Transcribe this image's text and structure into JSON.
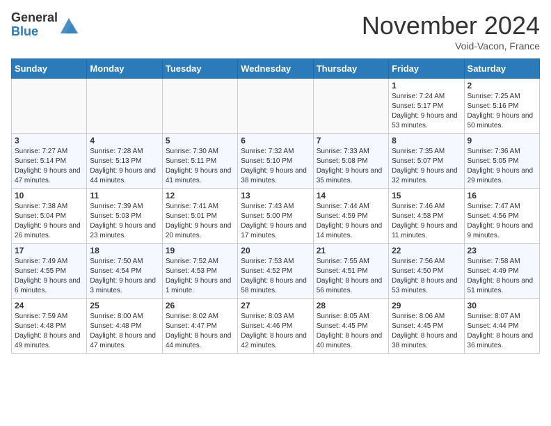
{
  "logo": {
    "general": "General",
    "blue": "Blue"
  },
  "header": {
    "month": "November 2024",
    "location": "Void-Vacon, France"
  },
  "weekdays": [
    "Sunday",
    "Monday",
    "Tuesday",
    "Wednesday",
    "Thursday",
    "Friday",
    "Saturday"
  ],
  "weeks": [
    [
      {
        "day": "",
        "info": ""
      },
      {
        "day": "",
        "info": ""
      },
      {
        "day": "",
        "info": ""
      },
      {
        "day": "",
        "info": ""
      },
      {
        "day": "",
        "info": ""
      },
      {
        "day": "1",
        "info": "Sunrise: 7:24 AM\nSunset: 5:17 PM\nDaylight: 9 hours and 53 minutes."
      },
      {
        "day": "2",
        "info": "Sunrise: 7:25 AM\nSunset: 5:16 PM\nDaylight: 9 hours and 50 minutes."
      }
    ],
    [
      {
        "day": "3",
        "info": "Sunrise: 7:27 AM\nSunset: 5:14 PM\nDaylight: 9 hours and 47 minutes."
      },
      {
        "day": "4",
        "info": "Sunrise: 7:28 AM\nSunset: 5:13 PM\nDaylight: 9 hours and 44 minutes."
      },
      {
        "day": "5",
        "info": "Sunrise: 7:30 AM\nSunset: 5:11 PM\nDaylight: 9 hours and 41 minutes."
      },
      {
        "day": "6",
        "info": "Sunrise: 7:32 AM\nSunset: 5:10 PM\nDaylight: 9 hours and 38 minutes."
      },
      {
        "day": "7",
        "info": "Sunrise: 7:33 AM\nSunset: 5:08 PM\nDaylight: 9 hours and 35 minutes."
      },
      {
        "day": "8",
        "info": "Sunrise: 7:35 AM\nSunset: 5:07 PM\nDaylight: 9 hours and 32 minutes."
      },
      {
        "day": "9",
        "info": "Sunrise: 7:36 AM\nSunset: 5:05 PM\nDaylight: 9 hours and 29 minutes."
      }
    ],
    [
      {
        "day": "10",
        "info": "Sunrise: 7:38 AM\nSunset: 5:04 PM\nDaylight: 9 hours and 26 minutes."
      },
      {
        "day": "11",
        "info": "Sunrise: 7:39 AM\nSunset: 5:03 PM\nDaylight: 9 hours and 23 minutes."
      },
      {
        "day": "12",
        "info": "Sunrise: 7:41 AM\nSunset: 5:01 PM\nDaylight: 9 hours and 20 minutes."
      },
      {
        "day": "13",
        "info": "Sunrise: 7:43 AM\nSunset: 5:00 PM\nDaylight: 9 hours and 17 minutes."
      },
      {
        "day": "14",
        "info": "Sunrise: 7:44 AM\nSunset: 4:59 PM\nDaylight: 9 hours and 14 minutes."
      },
      {
        "day": "15",
        "info": "Sunrise: 7:46 AM\nSunset: 4:58 PM\nDaylight: 9 hours and 11 minutes."
      },
      {
        "day": "16",
        "info": "Sunrise: 7:47 AM\nSunset: 4:56 PM\nDaylight: 9 hours and 9 minutes."
      }
    ],
    [
      {
        "day": "17",
        "info": "Sunrise: 7:49 AM\nSunset: 4:55 PM\nDaylight: 9 hours and 6 minutes."
      },
      {
        "day": "18",
        "info": "Sunrise: 7:50 AM\nSunset: 4:54 PM\nDaylight: 9 hours and 3 minutes."
      },
      {
        "day": "19",
        "info": "Sunrise: 7:52 AM\nSunset: 4:53 PM\nDaylight: 9 hours and 1 minute."
      },
      {
        "day": "20",
        "info": "Sunrise: 7:53 AM\nSunset: 4:52 PM\nDaylight: 8 hours and 58 minutes."
      },
      {
        "day": "21",
        "info": "Sunrise: 7:55 AM\nSunset: 4:51 PM\nDaylight: 8 hours and 56 minutes."
      },
      {
        "day": "22",
        "info": "Sunrise: 7:56 AM\nSunset: 4:50 PM\nDaylight: 8 hours and 53 minutes."
      },
      {
        "day": "23",
        "info": "Sunrise: 7:58 AM\nSunset: 4:49 PM\nDaylight: 8 hours and 51 minutes."
      }
    ],
    [
      {
        "day": "24",
        "info": "Sunrise: 7:59 AM\nSunset: 4:48 PM\nDaylight: 8 hours and 49 minutes."
      },
      {
        "day": "25",
        "info": "Sunrise: 8:00 AM\nSunset: 4:48 PM\nDaylight: 8 hours and 47 minutes."
      },
      {
        "day": "26",
        "info": "Sunrise: 8:02 AM\nSunset: 4:47 PM\nDaylight: 8 hours and 44 minutes."
      },
      {
        "day": "27",
        "info": "Sunrise: 8:03 AM\nSunset: 4:46 PM\nDaylight: 8 hours and 42 minutes."
      },
      {
        "day": "28",
        "info": "Sunrise: 8:05 AM\nSunset: 4:45 PM\nDaylight: 8 hours and 40 minutes."
      },
      {
        "day": "29",
        "info": "Sunrise: 8:06 AM\nSunset: 4:45 PM\nDaylight: 8 hours and 38 minutes."
      },
      {
        "day": "30",
        "info": "Sunrise: 8:07 AM\nSunset: 4:44 PM\nDaylight: 8 hours and 36 minutes."
      }
    ]
  ]
}
